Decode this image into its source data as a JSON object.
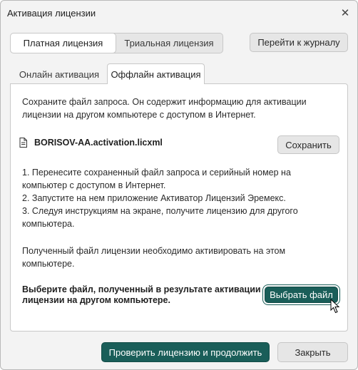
{
  "window": {
    "title": "Активация лицензии",
    "close_symbol": "✕"
  },
  "license_type": {
    "options": [
      "Платная лицензия",
      "Триальная лицензия"
    ],
    "selected": "Платная лицензия"
  },
  "journal_button": "Перейти к журналу",
  "tabs": [
    {
      "label": "Онлайн активация",
      "active": false
    },
    {
      "label": "Оффлайн активация",
      "active": true
    }
  ],
  "offline": {
    "intro_line1": "Сохраните файл запроса. Он содержит информацию для активации",
    "intro_line2": "лицензии на другом компьютере с доступом в Интернет.",
    "file_icon": "document-icon",
    "file_name": "BORISOV-AA.activation.licxml",
    "save_button": "Сохранить",
    "steps": [
      "1. Перенесите сохраненный файл запроса и серийный номер на",
      "компьютер с доступом в Интернет.",
      "2. Запустите на нем приложение Активатор Лицензий Эремекс.",
      "3. Следуя инструкциям на экране, получите лицензию для другого",
      "компьютера."
    ],
    "note_line1": "Полученный файл лицензии необходимо активировать на этом",
    "note_line2": "компьютере.",
    "select_prompt_line1": "Выберите файл, полученный в результате активации",
    "select_prompt_line2": "лицензии на другом компьютере.",
    "select_file_button": "Выбрать файл"
  },
  "footer": {
    "check_button": "Проверить лицензию и продолжить",
    "close_button": "Закрыть"
  },
  "colors": {
    "primary": "#1a5e59",
    "window_bg": "#f3f3f3",
    "panel_bg": "#ffffff"
  }
}
